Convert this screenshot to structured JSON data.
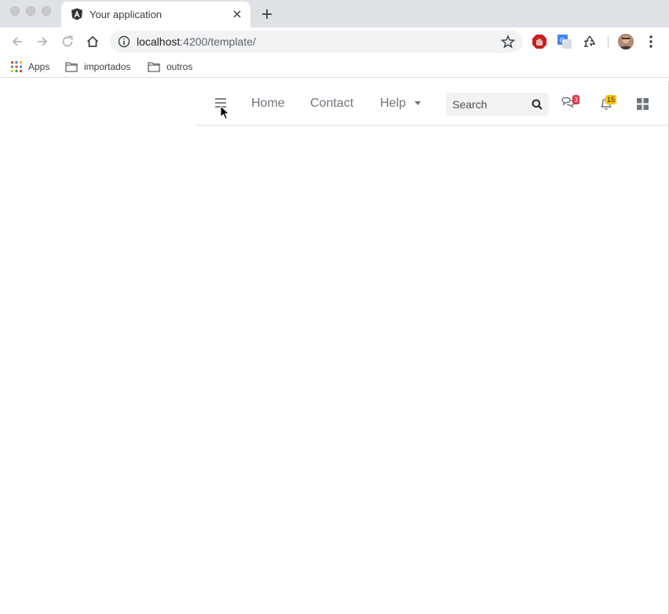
{
  "browser": {
    "tab": {
      "title": "Your application",
      "favicon": "angular-icon"
    },
    "address_bar": {
      "url_host": "localhost",
      "url_rest": ":4200/template/"
    },
    "bookmarks": [
      {
        "label": "Apps",
        "icon": "apps-grid-icon"
      },
      {
        "label": "importados",
        "icon": "folder-icon"
      },
      {
        "label": "outros",
        "icon": "folder-icon"
      }
    ],
    "extensions": [
      "adblock-icon",
      "google-translate-icon",
      "recycle-icon"
    ]
  },
  "app": {
    "nav": {
      "links": [
        {
          "label": "Home"
        },
        {
          "label": "Contact"
        },
        {
          "label": "Help"
        }
      ],
      "search": {
        "placeholder": "Search"
      },
      "messages": {
        "count": "3",
        "color": "#dc3545"
      },
      "notifications": {
        "count": "15",
        "color": "#ffc107"
      }
    }
  }
}
